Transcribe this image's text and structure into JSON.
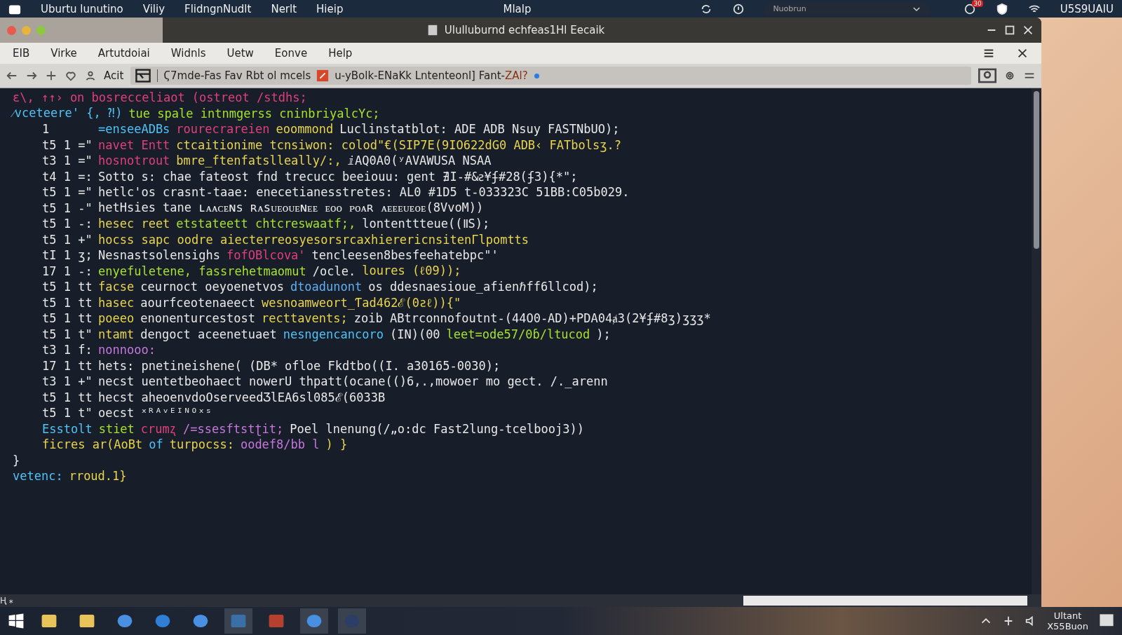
{
  "system_bar": {
    "menus": [
      "Uburtu lunutino",
      "Viliy",
      "FlidngnNudlt",
      "Nerlt",
      "Hieip"
    ],
    "center": "Mlalp",
    "account": "Nuobrun",
    "notification_count": "30",
    "clock": "U5S9UAIU"
  },
  "window": {
    "title": "Ululluburnd echfeas1Hl Eecaik"
  },
  "menu_bar": [
    "EIB",
    "Virke",
    "Artutdoiai",
    "Widnls",
    "Uetw",
    "Eonve",
    "Help"
  ],
  "toolbar": {
    "action": "Acit",
    "tab_label": "Ϛ7mde-Fas Fav Rbt ol mcels",
    "address": "u-yBolk-ENaKk Lntenteonl] Fant-",
    "address_tail": "ZAl?"
  },
  "code_lines": [
    {
      "kind": "plain",
      "segments": [
        {
          "text": "ɛ\\, ↑↑›  on bosrecceliaot (ostreot /stdhs;",
          "color": "#e0407a"
        }
      ]
    },
    {
      "kind": "plain",
      "segments": [
        {
          "text": "⁄vceteere' {, ⁈)",
          "color": "#4fc3f7"
        },
        {
          "text": "tue spale intnmgerss cninbriyalcYc;",
          "color": "#a6e22e"
        }
      ]
    },
    {
      "kind": "numbered",
      "gutter": "1",
      "segments": [
        {
          "text": "=enseeADBs",
          "color": "#4fc3f7"
        },
        {
          "text": "rourecrareien",
          "color": "#e0407a"
        },
        {
          "text": "eoommond",
          "color": "#e8d44d"
        },
        {
          "text": "Luclinstatblot: ADE ADB Nsuy FASTNbUO);",
          "color": "#e8e8e8"
        }
      ]
    },
    {
      "kind": "numbered",
      "gutter": "t5 1 =\"",
      "segments": [
        {
          "text": "navet Entt",
          "color": "#e0407a"
        },
        {
          "text": "ctcaitionime tcnsiwon: colod\"€(SIP7E(9IO622dG0 ADB‹ FATbolsʒ.?",
          "color": "#e8d44d"
        }
      ]
    },
    {
      "kind": "numbered",
      "gutter": "t3 1 =\"",
      "segments": [
        {
          "text": "hosnotrout",
          "color": "#e0407a"
        },
        {
          "text": "bmre_ftenfatslleally/:,",
          "color": "#e8d44d"
        },
        {
          "text": "ⅈAQ0A0(ʸAVAWUSA NSAA",
          "color": "#e8e8e8"
        }
      ]
    },
    {
      "kind": "numbered",
      "gutter": "t4 1 =:",
      "segments": [
        {
          "text": "Sotto s: chae fateost fnd trecucc beeiouu: gent ∄I-#&ꙅ¥ʄ#28(ʄ3){*\";",
          "color": "#e8e8e8"
        }
      ]
    },
    {
      "kind": "numbered",
      "gutter": "t5 1 =\"",
      "segments": [
        {
          "text": "hetlc'os crasnt-taae: enecetianesstretes: AL0 #1D5 t-033323C 51BB:C05b029.",
          "color": "#e8e8e8"
        }
      ]
    },
    {
      "kind": "numbered",
      "gutter": "t5 1 -\"",
      "segments": [
        {
          "text": "hetHsies tane ʟᴀᴀᴄᴇɴs ʀᴀsᴜᴇᴏᴜᴇɴᴇᴇ ᴇᴏᴏ ᴘᴏᴀʀ ᴀᴇᴇᴇᴜᴇᴏᴇ(8VvoM))",
          "color": "#e8e8e8"
        }
      ]
    },
    {
      "kind": "numbered",
      "gutter": "t5 1 -:",
      "segments": [
        {
          "text": "hesec reet",
          "color": "#e8d44d"
        },
        {
          "text": "etstateett chtcreswaatf;,",
          "color": "#a6e22e"
        },
        {
          "text": "lontenttteue((ⅡS);",
          "color": "#e8e8e8"
        }
      ]
    },
    {
      "kind": "numbered",
      "gutter": "t5 1 +\"",
      "segments": [
        {
          "text": "hocss sapc oodre aiecterreosyesorsrcaxhierericnsitenΓlpomtts",
          "color": "#e8d44d"
        }
      ]
    },
    {
      "kind": "numbered",
      "gutter": "tI 1 ʒ;",
      "segments": [
        {
          "text": "Nesnastsolensighs",
          "color": "#e8e8e8"
        },
        {
          "text": "fofOBlcova'",
          "color": "#e0407a"
        },
        {
          "text": "tenclеesen8besfeehatebpc\"'",
          "color": "#e8e8e8"
        }
      ]
    },
    {
      "kind": "numbered",
      "gutter": "17 1 -:",
      "segments": [
        {
          "text": "enyefuletene, fassrehetmaomut",
          "color": "#a6e22e"
        },
        {
          "text": "/ocle.",
          "color": "#e8e8e8"
        },
        {
          "text": "loures (ℓ09));",
          "color": "#e8d44d"
        }
      ]
    },
    {
      "kind": "numbered",
      "gutter": "t5 1 tt",
      "segments": [
        {
          "text": "facse",
          "color": "#e8d44d"
        },
        {
          "text": "ceurnoct oeyoenetvos",
          "color": "#e8e8e8"
        },
        {
          "text": "dtoadunont",
          "color": "#61afef"
        },
        {
          "text": "os ddesnaesioue_afienℏff6llcod);",
          "color": "#e8e8e8"
        }
      ]
    },
    {
      "kind": "numbered",
      "gutter": "t5 1 tt",
      "segments": [
        {
          "text": "hasec",
          "color": "#e8d44d"
        },
        {
          "text": "aourfceotenaeect",
          "color": "#e8e8e8"
        },
        {
          "text": "wesnoamweort_Ƭad462ℰ(0ƨℓ)){\"",
          "color": "#e8d44d"
        }
      ]
    },
    {
      "kind": "numbered",
      "gutter": "t5 1 tt",
      "segments": [
        {
          "text": "poeeo",
          "color": "#e8d44d"
        },
        {
          "text": "enonenturcestost",
          "color": "#e8e8e8"
        },
        {
          "text": "recttavents;",
          "color": "#e8d44d"
        },
        {
          "text": "zoib ABtrconnofoutnt-(44O0-AD)+PDA04ⱥ3(2¥ʄ#8ʒ)ʒʒʒ*",
          "color": "#e8e8e8"
        }
      ]
    },
    {
      "kind": "numbered",
      "gutter": "t5 1 t\"",
      "segments": [
        {
          "text": "ntamt",
          "color": "#e8d44d"
        },
        {
          "text": "dengoct aceenetuaet",
          "color": "#e8e8e8"
        },
        {
          "text": "nesngencancoro",
          "color": "#4fc3f7"
        },
        {
          "text": "(IN)(00",
          "color": "#e8e8e8"
        },
        {
          "text": "leet=ode57/0ɓ/ltucod",
          "color": "#a6e22e"
        },
        {
          "text": ");",
          "color": "#e8e8e8"
        }
      ]
    },
    {
      "kind": "numbered",
      "gutter": "t3 1 f:",
      "segments": [
        {
          "text": "nonnooo:",
          "color": "#c678dd"
        }
      ]
    },
    {
      "kind": "numbered",
      "gutter": "17 1 tt",
      "segments": [
        {
          "text": "hets: pnetineishene( (DB* ofloe Fkdtbo((I. a30165-0030);",
          "color": "#e8e8e8"
        }
      ]
    },
    {
      "kind": "numbered",
      "gutter": "t3 1 +\"",
      "segments": [
        {
          "text": "necst uentetbeohaect nowerU thpatt(ocane(()6,.,mowoer mo gect. /._arenn",
          "color": "#e8e8e8"
        }
      ]
    },
    {
      "kind": "numbered",
      "gutter": "t5 1 tt",
      "segments": [
        {
          "text": "hecst aheoenvdoOserveedƷlEA6sl085ℰ(6033B",
          "color": "#e8e8e8"
        }
      ]
    },
    {
      "kind": "numbered",
      "gutter": "t5 1 t\"",
      "segments": [
        {
          "text": "oecst",
          "color": "#e8e8e8"
        },
        {
          "text": "ˣᴿᴬᵛᴱᴵᴺᴼˣˢ",
          "color": "#e8e8e8"
        }
      ]
    },
    {
      "kind": "indented",
      "segments": [
        {
          "text": "Esstolt",
          "color": "#4fc3f7"
        },
        {
          "text": "stiet",
          "color": "#a6e22e"
        },
        {
          "text": "crumʐ",
          "color": "#e0407a"
        },
        {
          "text": "/=ssesftstʈit;",
          "color": "#c678dd"
        },
        {
          "text": "Poel lnenung(/„o:dc Fast2lung-tcelbooj3))",
          "color": "#e8e8e8"
        }
      ]
    },
    {
      "kind": "indented",
      "segments": [
        {
          "text": "ficres ar(AoBt",
          "color": "#e8d44d"
        },
        {
          "text": "of",
          "color": "#4fc3f7"
        },
        {
          "text": "turpocss:",
          "color": "#e8d44d"
        },
        {
          "text": "oodef8/bb l",
          "color": "#c678dd"
        },
        {
          "text": ") }",
          "color": "#e8d44d"
        }
      ]
    },
    {
      "kind": "plain",
      "segments": [
        {
          "text": "}",
          "color": "#e8e8e8"
        }
      ]
    },
    {
      "kind": "plain",
      "segments": [
        {
          "text": "vetenc:",
          "color": "#4fc3f7"
        },
        {
          "text": "rroud.1}",
          "color": "#e8d44d"
        }
      ]
    }
  ],
  "status": "Ⱨ ⁎",
  "taskbar": {
    "clock_top": "Ultant",
    "clock_bottom": "X55Buon"
  }
}
